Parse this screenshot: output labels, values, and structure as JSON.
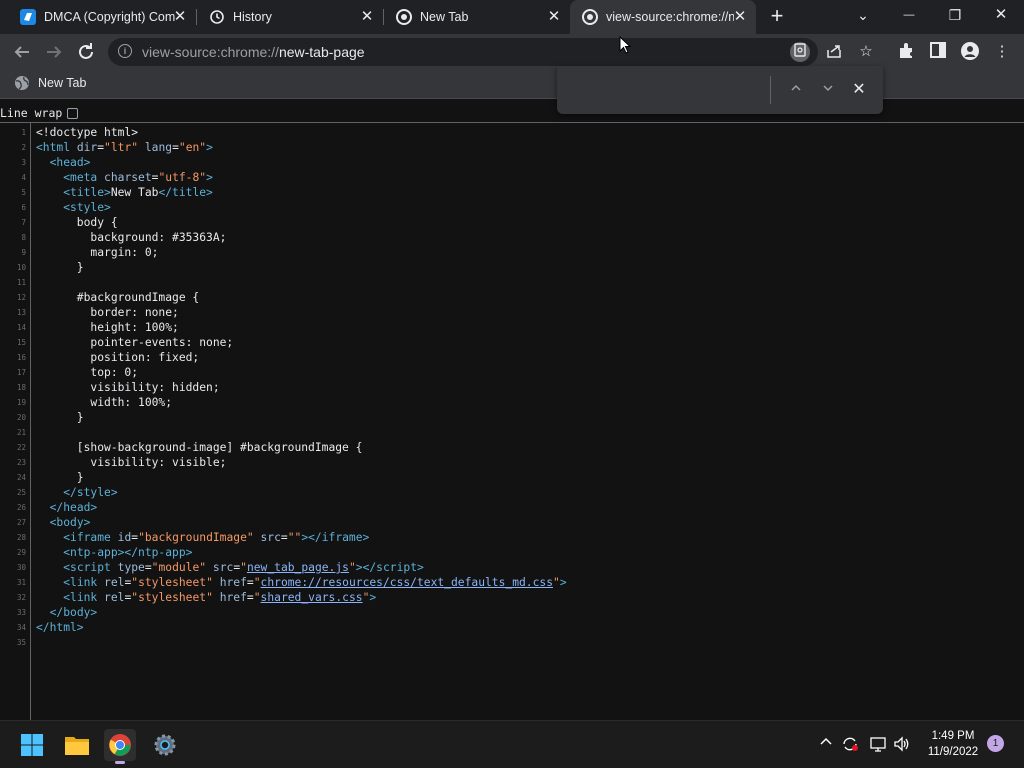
{
  "tabs": [
    {
      "label": "DMCA (Copyright) Com",
      "icon": "dmca-icon",
      "active": false
    },
    {
      "label": "History",
      "icon": "history-icon",
      "active": false
    },
    {
      "label": "New Tab",
      "icon": "chrome-icon",
      "active": false
    },
    {
      "label": "view-source:chrome://n",
      "icon": "chrome-icon",
      "active": true
    }
  ],
  "window_controls": {
    "tab_search": "⌄",
    "minimize": "—",
    "restore": "❐",
    "close": "✕"
  },
  "address_bar": {
    "scheme": "view-source:chrome://",
    "host": "new-tab-page"
  },
  "bookmarks": [
    {
      "label": "New Tab"
    }
  ],
  "source_view": {
    "line_wrap_label": "Line wrap",
    "lines": [
      {
        "n": "1",
        "html": "&lt;!doctype html&gt;"
      },
      {
        "n": "2",
        "html": "<span class='tg'>&lt;html</span> <span class='an'>dir</span>=<span class='av'>\"ltr\"</span> <span class='an'>lang</span>=<span class='av'>\"en\"</span><span class='tg'>&gt;</span>"
      },
      {
        "n": "3",
        "html": "  <span class='tg'>&lt;head&gt;</span>"
      },
      {
        "n": "4",
        "html": "    <span class='tg'>&lt;meta</span> <span class='an'>charset</span>=<span class='av'>\"utf-8\"</span><span class='tg'>&gt;</span>"
      },
      {
        "n": "5",
        "html": "    <span class='tg'>&lt;title&gt;</span>New Tab<span class='tg'>&lt;/title&gt;</span>"
      },
      {
        "n": "6",
        "html": "    <span class='tg'>&lt;style&gt;</span>"
      },
      {
        "n": "7",
        "html": "      body {"
      },
      {
        "n": "8",
        "html": "        background: #35363A;"
      },
      {
        "n": "9",
        "html": "        margin: 0;"
      },
      {
        "n": "10",
        "html": "      }"
      },
      {
        "n": "11",
        "html": ""
      },
      {
        "n": "12",
        "html": "      #backgroundImage {"
      },
      {
        "n": "13",
        "html": "        border: none;"
      },
      {
        "n": "14",
        "html": "        height: 100%;"
      },
      {
        "n": "15",
        "html": "        pointer-events: none;"
      },
      {
        "n": "16",
        "html": "        position: fixed;"
      },
      {
        "n": "17",
        "html": "        top: 0;"
      },
      {
        "n": "18",
        "html": "        visibility: hidden;"
      },
      {
        "n": "19",
        "html": "        width: 100%;"
      },
      {
        "n": "20",
        "html": "      }"
      },
      {
        "n": "21",
        "html": ""
      },
      {
        "n": "22",
        "html": "      [show-background-image] #backgroundImage {"
      },
      {
        "n": "23",
        "html": "        visibility: visible;"
      },
      {
        "n": "24",
        "html": "      }"
      },
      {
        "n": "25",
        "html": "    <span class='tg'>&lt;/style&gt;</span>"
      },
      {
        "n": "26",
        "html": "  <span class='tg'>&lt;/head&gt;</span>"
      },
      {
        "n": "27",
        "html": "  <span class='tg'>&lt;body&gt;</span>"
      },
      {
        "n": "28",
        "html": "    <span class='tg'>&lt;iframe</span> <span class='an'>id</span>=<span class='av'>\"backgroundImage\"</span> <span class='an'>src</span>=<span class='av'>\"\"</span><span class='tg'>&gt;&lt;/iframe&gt;</span>"
      },
      {
        "n": "29",
        "html": "    <span class='tg'>&lt;ntp-app&gt;&lt;/ntp-app&gt;</span>"
      },
      {
        "n": "30",
        "html": "    <span class='tg'>&lt;script</span> <span class='an'>type</span>=<span class='av'>\"module\"</span> <span class='an'>src</span>=<span class='av'>\"</span><span class='lk'>new_tab_page.js</span><span class='av'>\"</span><span class='tg'>&gt;&lt;/script&gt;</span>"
      },
      {
        "n": "31",
        "html": "    <span class='tg'>&lt;link</span> <span class='an'>rel</span>=<span class='av'>\"stylesheet\"</span> <span class='an'>href</span>=<span class='av'>\"</span><span class='lk'>chrome://resources/css/text_defaults_md.css</span><span class='av'>\"</span><span class='tg'>&gt;</span>"
      },
      {
        "n": "32",
        "html": "    <span class='tg'>&lt;link</span> <span class='an'>rel</span>=<span class='av'>\"stylesheet\"</span> <span class='an'>href</span>=<span class='av'>\"</span><span class='lk'>shared_vars.css</span><span class='av'>\"</span><span class='tg'>&gt;</span>"
      },
      {
        "n": "33",
        "html": "  <span class='tg'>&lt;/body&gt;</span>"
      },
      {
        "n": "34",
        "html": "<span class='tg'>&lt;/html&gt;</span>"
      },
      {
        "n": "35",
        "html": ""
      }
    ]
  },
  "taskbar": {
    "apps": [
      {
        "name": "start-button",
        "icon": "windows-icon"
      },
      {
        "name": "file-explorer-button",
        "icon": "folder-icon"
      },
      {
        "name": "chrome-taskbar-button",
        "icon": "chrome-icon",
        "active": true
      },
      {
        "name": "settings-button",
        "icon": "gear-icon"
      }
    ],
    "time": "1:49 PM",
    "date": "11/9/2022",
    "notification_count": "1"
  },
  "colors": {
    "tab_strip": "#202124",
    "toolbar": "#35363a",
    "source_bg": "#121212",
    "tag": "#5db0d7",
    "attr_value": "#f29766",
    "link": "#8ab4f8"
  }
}
